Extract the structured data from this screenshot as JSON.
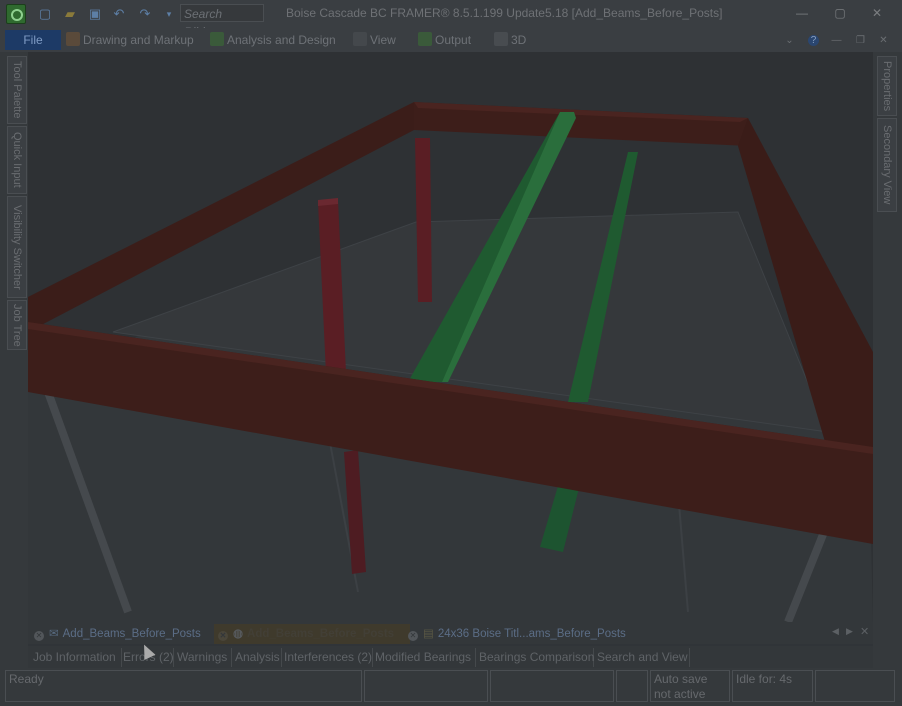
{
  "titlebar": {
    "search_placeholder": "Search Ribbon",
    "title": "Boise Cascade BC FRAMER® 8.5.1.199 Update5.18 [Add_Beams_Before_Posts]",
    "window_controls": [
      "minimize-icon",
      "maximize-icon",
      "close-icon"
    ]
  },
  "ribbon": {
    "file_label": "File",
    "tabs": [
      {
        "label": "Drawing and Markup",
        "icon": "drawing-icon"
      },
      {
        "label": "Analysis and Design",
        "icon": "analysis-icon"
      },
      {
        "label": "View",
        "icon": "view-icon"
      },
      {
        "label": "Output",
        "icon": "output-icon"
      },
      {
        "label": "3D",
        "icon": "3d-icon"
      }
    ]
  },
  "left_panel": [
    "Tool Palette",
    "Quick Input",
    "Visibility Switcher",
    "Job Tree"
  ],
  "right_panel": [
    "Properties",
    "Secondary View"
  ],
  "doc_tabs": [
    {
      "label": "Add_Beams_Before_Posts",
      "active": false
    },
    {
      "label": "Add_Beams_Before_Posts",
      "active": true
    },
    {
      "label": "24x36 Boise Titl...ams_Before_Posts",
      "active": false
    }
  ],
  "bottom_tabs": [
    "Job Information",
    "Errors (2)",
    "Warnings",
    "Analysis",
    "Interferences (2)",
    "Modified Bearings",
    "Bearings Comparison",
    "Search and View"
  ],
  "status": {
    "ready": "Ready",
    "autosave": "Auto save not active",
    "idle": "Idle for: 4s"
  },
  "colors": {
    "beam": "#3d1e1a",
    "green_beam": "#1f5a30",
    "post": "#5a1e24"
  }
}
